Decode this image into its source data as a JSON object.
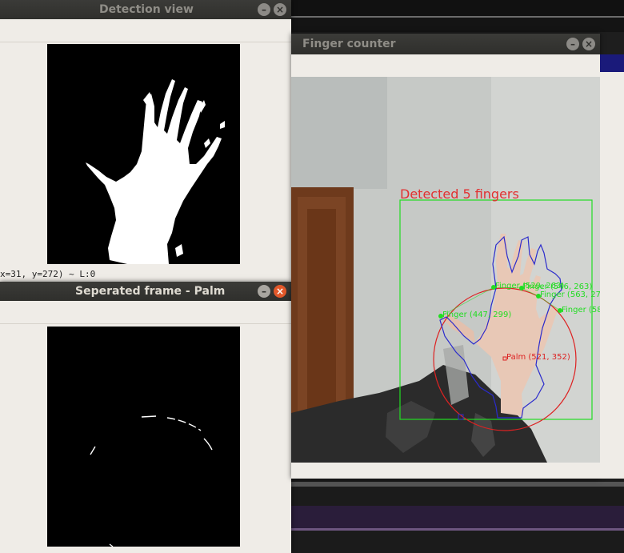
{
  "windows": {
    "detection": {
      "title": "Detection view",
      "status": "x=31, y=272) ~ L:0"
    },
    "palm": {
      "title": "Seperated frame - Palm"
    },
    "finger_counter": {
      "title": "Finger counter",
      "overlay": {
        "detected_text": "Detected 5 fingers",
        "palm_label": "Palm (521, 352)",
        "finger_labels": [
          "Finger (447, 299)",
          "Finger (520, 263)",
          "Finger (546, 263)",
          "Finger (563, 27",
          "Finger (58"
        ]
      },
      "colors": {
        "bounding_box": "#22dd22",
        "palm_circle": "#dd2222",
        "contour": "#2222cc"
      }
    }
  },
  "controls": {
    "minimize_symbol": "–",
    "close_symbol": "×"
  }
}
